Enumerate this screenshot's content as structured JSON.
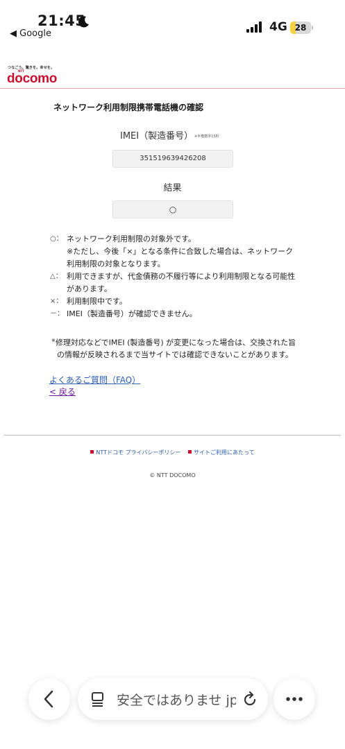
{
  "status_bar": {
    "time": "21:45",
    "back_app": "◀ Google",
    "network": "4G",
    "battery": "28",
    "battery_level": 0.28
  },
  "header": {
    "tagline": "つなごう。驚きを。幸せを。",
    "ntt": "NTT",
    "logo": "docomo"
  },
  "page": {
    "title": "ネットワーク利用制限携帯電話機の確認",
    "imei_label": "IMEI（製造番号）",
    "imei_note": "※半角数字15桁",
    "imei_value": "351519639426208",
    "result_label": "結果",
    "result_value": "○"
  },
  "legend": [
    {
      "mark": "○：",
      "text": "ネットワーク利用制限の対象外です。"
    },
    {
      "mark": "",
      "text": "※ただし、今後「×」となる条件に合致した場合は、ネットワーク利用制限の対象となります。"
    },
    {
      "mark": "△：",
      "text": "利用できますが、代金債務の不履行等により利用制限となる可能性があります。"
    },
    {
      "mark": "×：",
      "text": "利用制限中です。"
    },
    {
      "mark": "－：",
      "text": "IMEI（製造番号）が確認できません。"
    }
  ],
  "note": {
    "mark": "※",
    "text": "修理対応などでIMEI (製造番号) が変更になった場合は、交換された旨の情報が反映されるまで当サイトでは確認できないことがあります。"
  },
  "links": {
    "faq": "よくあるご質問（FAQ）",
    "back": "< 戻る"
  },
  "footer": {
    "privacy": "NTTドコモ プライバシーポリシー",
    "terms": "サイトご利用にあたって",
    "copyright": "© NTT DOCOMO"
  },
  "browser_bar": {
    "url_text": "安全ではありませ jp",
    "icons": [
      "back-chevron-icon",
      "tabs-icon",
      "reload-icon",
      "more-icon"
    ]
  },
  "colors": {
    "brand_red": "#c8102e",
    "link_blue": "#2a5db0",
    "visited_purple": "#6a1b9a"
  }
}
